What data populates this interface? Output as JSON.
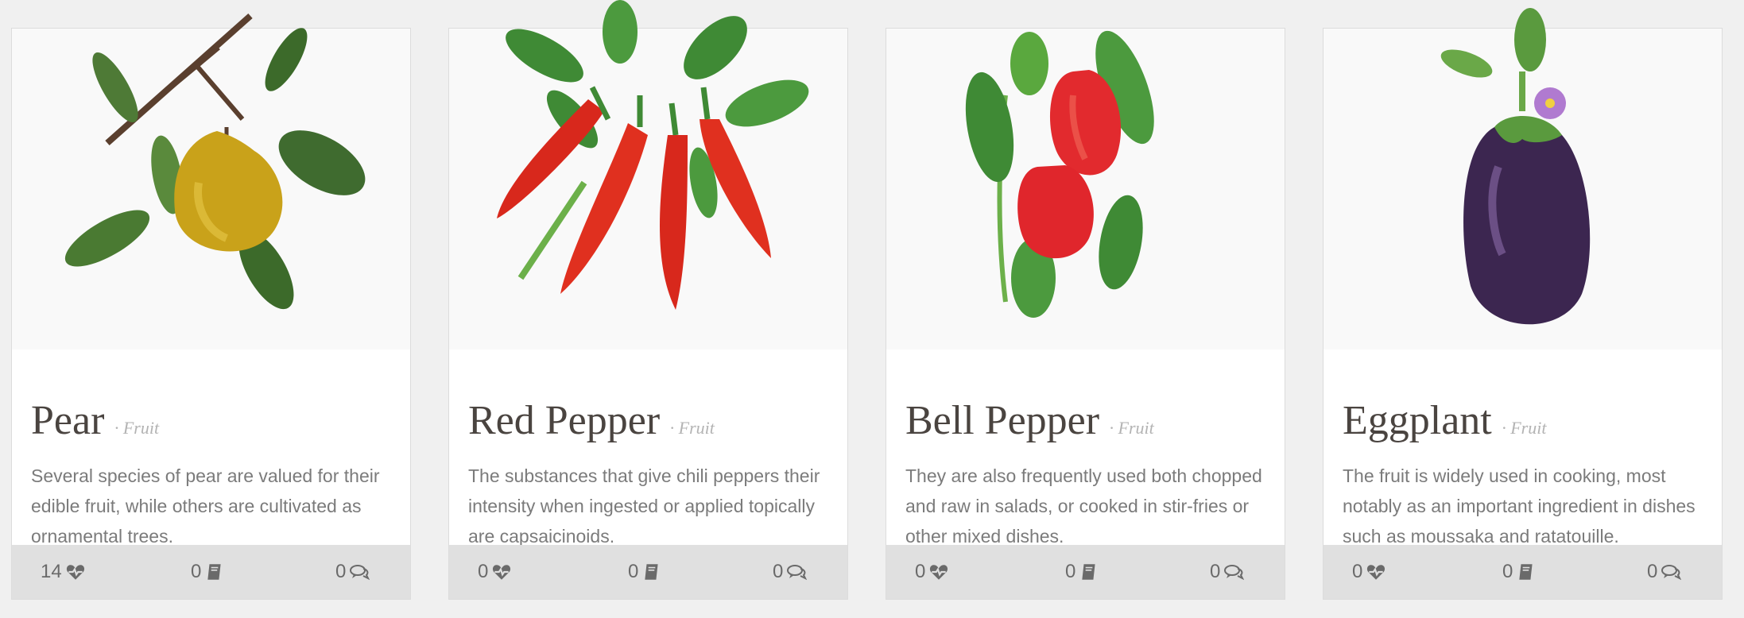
{
  "cards": [
    {
      "title": "Pear",
      "category": "· Fruit",
      "description": "Several species of pear are valued for their edible fruit, while others are cultivated as ornamental trees.",
      "likes": "14",
      "docs": "0",
      "comments": "0",
      "icon": "pear-illustration"
    },
    {
      "title": "Red Pepper",
      "category": "· Fruit",
      "description": "The substances that give chili peppers their intensity when ingested or applied topically are capsaicinoids.",
      "likes": "0",
      "docs": "0",
      "comments": "0",
      "icon": "red-pepper-illustration"
    },
    {
      "title": "Bell Pepper",
      "category": "· Fruit",
      "description": "They are also frequently used both chopped and raw in salads, or cooked in stir-fries or other mixed dishes.",
      "likes": "0",
      "docs": "0",
      "comments": "0",
      "icon": "bell-pepper-illustration"
    },
    {
      "title": "Eggplant",
      "category": "· Fruit",
      "description": "The fruit is widely used in cooking, most notably as an important ingredient in dishes such as moussaka and ratatouille.",
      "likes": "0",
      "docs": "0",
      "comments": "0",
      "icon": "eggplant-illustration"
    }
  ],
  "icons": {
    "likes": "heartbeat-icon",
    "docs": "book-icon",
    "comments": "comments-icon"
  },
  "colors": {
    "background": "#f0f0f0",
    "footer": "#e0e0e0",
    "title": "#4a4440",
    "category": "#b3b3b3",
    "text": "#7b7b7b"
  }
}
